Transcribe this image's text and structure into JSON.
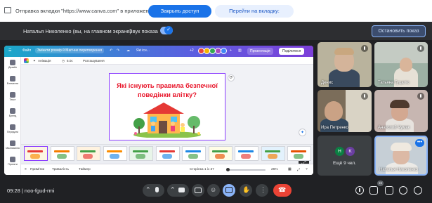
{
  "notification": {
    "message": "Отправка вкладки \"https://www.canva.com\" в приложение \"meet.google.com\"...",
    "stop_label": "Закрыть доступ",
    "goto_label": "Перейти на вкладку: www.canva.com"
  },
  "share_bar": {
    "presenter_text": "Наталья Николенко (вы, на главном экране)",
    "sound_label": "Звук показа",
    "sound_on": true,
    "stop_show_label": "Остановить показ"
  },
  "canva": {
    "menu_file": "Файл",
    "resize_label": "Змінити розмір й Магічне перетворення",
    "title_short": "Які існ...",
    "counter": "+2",
    "present_label": "Презентація",
    "share_label": "Поділитися",
    "toolbar_animation": "Анімація",
    "toolbar_duration": "5.0с",
    "toolbar_position": "Розташування",
    "sidebar": [
      {
        "icon": "layout-icon",
        "label": "Дизайн"
      },
      {
        "icon": "elements-icon",
        "label": "Елементи"
      },
      {
        "icon": "text-icon",
        "label": "Текст"
      },
      {
        "icon": "brand-icon",
        "label": "Бренд"
      },
      {
        "icon": "upload-icon",
        "label": "Передати"
      },
      {
        "icon": "draw-icon",
        "label": "Малювання"
      },
      {
        "icon": "projects-icon",
        "label": "Проєкти"
      }
    ],
    "slide_title": "Які існують правила безпечної поведінки влітку?",
    "thumb_count": 11,
    "active_thumb": 1,
    "bottom_notes": "Примітки",
    "bottom_duration": "Тривалість",
    "bottom_timer": "Таймер",
    "page_indicator": "Сторінка 1 із 37",
    "zoom": "26%"
  },
  "participants": [
    {
      "name": "Денис",
      "muted": true
    },
    {
      "name": "Татьяна Гуцалю",
      "muted": true
    },
    {
      "name": "Ира Петренко",
      "muted": true
    },
    {
      "name": "Анатолий Чумак",
      "muted": true
    },
    {
      "name": "Наталья Николенко",
      "muted": false
    }
  ],
  "more_tile": {
    "label": "Ещё 9 чел.",
    "initials": [
      "Н",
      "K"
    ],
    "colors": [
      "#0b8043",
      "#6a3ea1"
    ]
  },
  "meeting": {
    "time": "09:28",
    "code": "noo-fgud-rmi",
    "participant_count": "15"
  },
  "colors": {
    "accent": "#1a73e8",
    "end_call": "#ea4335",
    "canva_purple": "#8b3dff"
  }
}
